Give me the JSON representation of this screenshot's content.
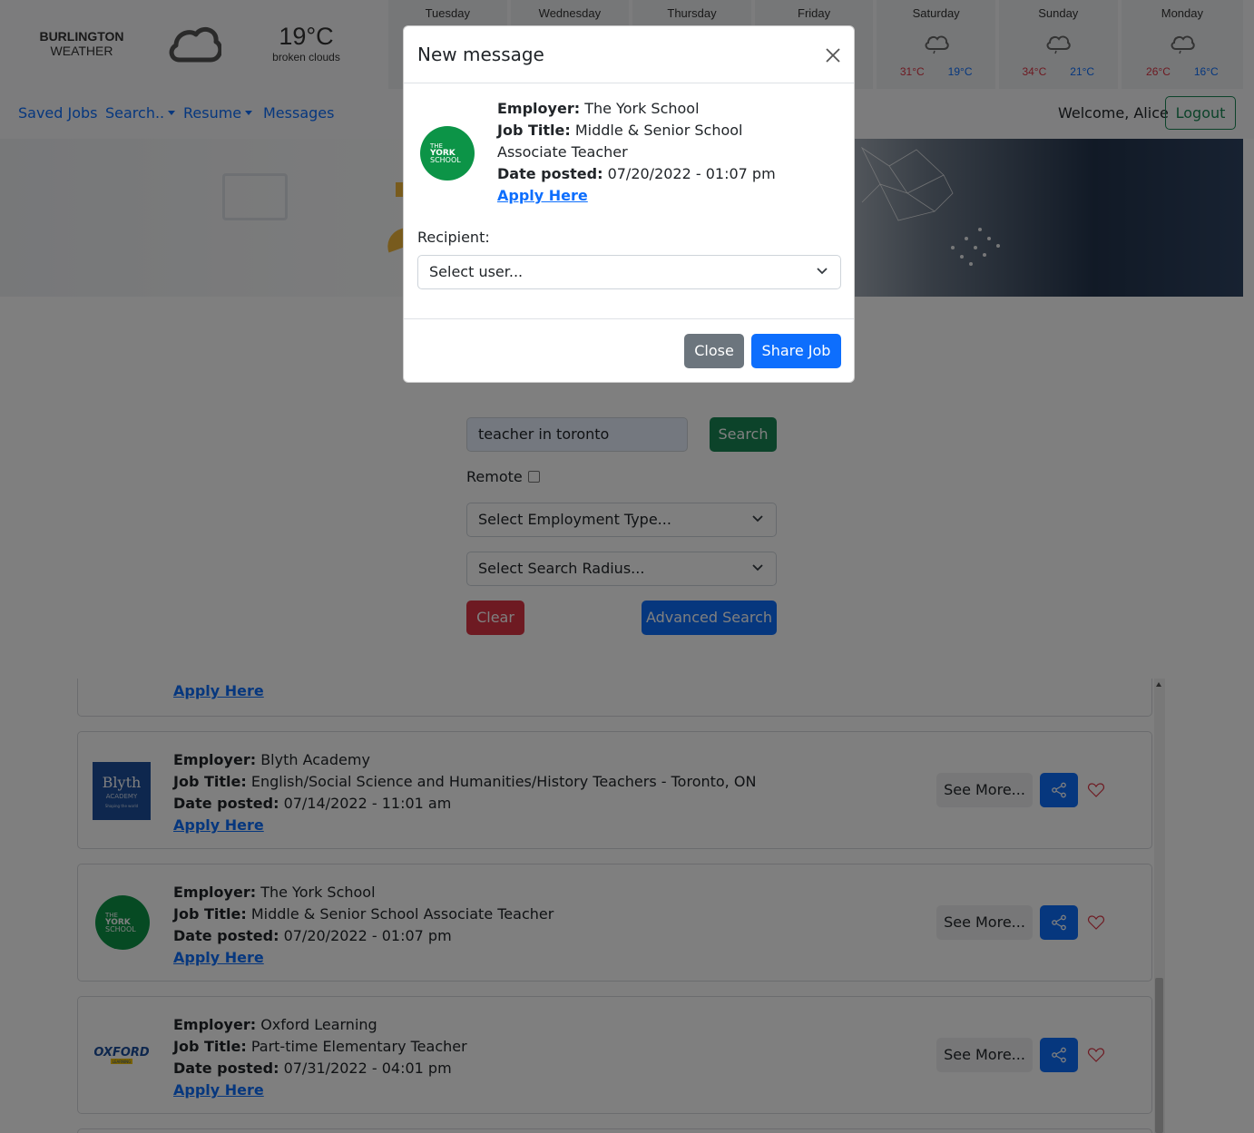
{
  "weather": {
    "city": "BURLINGTON",
    "label": "WEATHER",
    "current_temp": "19°C",
    "current_desc": "broken clouds",
    "current_icon": "cloud-icon",
    "days": [
      {
        "name": "Tuesday",
        "high": "",
        "low": ""
      },
      {
        "name": "Wednesday",
        "high": "",
        "low": ""
      },
      {
        "name": "Thursday",
        "high": "",
        "low": ""
      },
      {
        "name": "Friday",
        "high": "",
        "low": ""
      },
      {
        "name": "Saturday",
        "high": "31°C",
        "low": "19°C",
        "icon": "rain-cloud-icon"
      },
      {
        "name": "Sunday",
        "high": "34°C",
        "low": "21°C",
        "icon": "rain-cloud-icon"
      },
      {
        "name": "Monday",
        "high": "26°C",
        "low": "16°C",
        "icon": "rain-cloud-icon"
      }
    ]
  },
  "nav": {
    "saved_jobs": "Saved Jobs",
    "search": "Search..",
    "resume": "Resume",
    "messages": "Messages",
    "welcome": "Welcome, Alice",
    "logout": "Logout"
  },
  "search": {
    "query": "teacher in toronto",
    "search_button": "Search",
    "remote_label": "Remote",
    "remote_checked": false,
    "employment_type": "Select Employment Type...",
    "search_radius": "Select Search Radius...",
    "clear_button": "Clear",
    "advanced_button": "Advanced Search"
  },
  "results": {
    "employer_label": "Employer:",
    "title_label": "Job Title:",
    "date_label": "Date posted:",
    "apply_label": "Apply Here",
    "see_more_label": "See More...",
    "items": [
      {
        "employer": "Blyth Academy",
        "title": "English/Social Science and Humanities/History Teachers - Toronto, ON",
        "date": "07/14/2022 - 11:01 am",
        "logo": "blyth-academy-logo"
      },
      {
        "employer": "The York School",
        "title": "Middle & Senior School Associate Teacher",
        "date": "07/20/2022 - 01:07 pm",
        "logo": "york-school-logo"
      },
      {
        "employer": "Oxford Learning",
        "title": "Part-time Elementary Teacher",
        "date": "07/31/2022 - 04:01 pm",
        "logo": "oxford-learning-logo"
      }
    ]
  },
  "modal": {
    "title": "New message",
    "employer_label": "Employer:",
    "employer": "The York School",
    "title_label": "Job Title:",
    "job_title": "Middle & Senior School Associate Teacher",
    "date_label": "Date posted:",
    "date": "07/20/2022 - 01:07 pm",
    "apply_label": "Apply Here",
    "recipient_label": "Recipient:",
    "recipient_placeholder": "Select user...",
    "close_button": "Close",
    "share_button": "Share Job"
  },
  "colors": {
    "primary": "#0d6efd",
    "success": "#198754",
    "danger": "#dc3545",
    "secondary": "#6c757d"
  }
}
